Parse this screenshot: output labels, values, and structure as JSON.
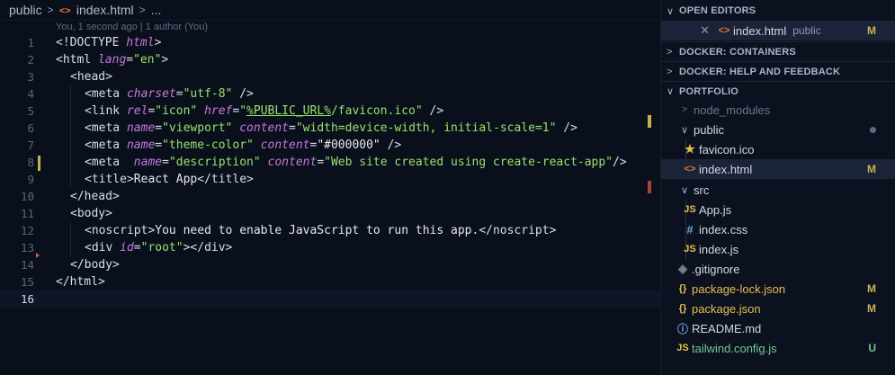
{
  "breadcrumb": {
    "folder": "public",
    "file": "index.html",
    "more": "..."
  },
  "blame": "You, 1 second ago | 1 author (You)",
  "editor": {
    "lines": [
      {
        "n": "1"
      },
      {
        "n": "2"
      },
      {
        "n": "3"
      },
      {
        "n": "4"
      },
      {
        "n": "5"
      },
      {
        "n": "6"
      },
      {
        "n": "7"
      },
      {
        "n": "8"
      },
      {
        "n": "9"
      },
      {
        "n": "10"
      },
      {
        "n": "11"
      },
      {
        "n": "12"
      },
      {
        "n": "13"
      },
      {
        "n": "14"
      },
      {
        "n": "15"
      },
      {
        "n": "16"
      }
    ],
    "code": {
      "l1_doctype": "<!DOCTYPE ",
      "l1_html": "html",
      "l1_close": ">",
      "l2_open": "<html ",
      "l2_attr": "lang",
      "l2_eq": "=",
      "l2_val": "\"en\"",
      "l2_close": ">",
      "l3": "<head>",
      "l4_open": "<meta ",
      "l4_attr": "charset",
      "l4_eq": "=",
      "l4_val": "\"utf-8\"",
      "l4_close": " />",
      "l5_open": "<link ",
      "l5_attr1": "rel",
      "l5_eq1": "=",
      "l5_val1": "\"icon\"",
      "l5_sp": " ",
      "l5_attr2": "href",
      "l5_eq2": "=",
      "l5_q1": "\"",
      "l5_val2": "%PUBLIC_URL%",
      "l5_val2b": "/favicon.ico",
      "l5_q2": "\"",
      "l5_close": " />",
      "l6_open": "<meta ",
      "l6_attr1": "name",
      "l6_eq1": "=",
      "l6_val1": "\"viewport\"",
      "l6_sp": " ",
      "l6_attr2": "content",
      "l6_eq2": "=",
      "l6_val2": "\"width=device-width, initial-scale=1\"",
      "l6_close": " />",
      "l7_open": "<meta ",
      "l7_attr1": "name",
      "l7_eq1": "=",
      "l7_val1": "\"theme-color\"",
      "l7_sp": " ",
      "l7_attr2": "content",
      "l7_eq2": "=",
      "l7_val2": "\"#000000\"",
      "l7_close": " />",
      "l8_open": "<meta  ",
      "l8_attr1": "name",
      "l8_eq1": "=",
      "l8_val1": "\"description\"",
      "l8_sp": " ",
      "l8_attr2": "content",
      "l8_eq2": "=",
      "l8_val2": "\"Web site created using create-react-app\"",
      "l8_close": "/>",
      "l9_open": "<title>",
      "l9_text": "React App",
      "l9_close": "</title>",
      "l10": "</head>",
      "l11": "<body>",
      "l12_open": "<noscript>",
      "l12_text": "You need to enable JavaScript to run this app.",
      "l12_close": "</noscript>",
      "l13_open": "<div ",
      "l13_attr": "id",
      "l13_eq": "=",
      "l13_val": "\"root\"",
      "l13_close": "></div>",
      "l14": "</body>",
      "l15": "</html>"
    }
  },
  "sidebar": {
    "open_editors": {
      "header": "OPEN EDITORS",
      "item": {
        "name": "index.html",
        "folder": "public",
        "status": "M"
      }
    },
    "docker_containers": "DOCKER: CONTAINERS",
    "docker_help": "DOCKER: HELP AND FEEDBACK",
    "portfolio": {
      "header": "PORTFOLIO",
      "items": [
        {
          "name": "node_modules"
        },
        {
          "name": "public"
        },
        {
          "name": "favicon.ico"
        },
        {
          "name": "index.html",
          "status": "M"
        },
        {
          "name": "src"
        },
        {
          "name": "App.js"
        },
        {
          "name": "index.css"
        },
        {
          "name": "index.js"
        },
        {
          "name": ".gitignore"
        },
        {
          "name": "package-lock.json",
          "status": "M"
        },
        {
          "name": "package.json",
          "status": "M"
        },
        {
          "name": "README.md"
        },
        {
          "name": "tailwind.config.js",
          "status": "U"
        }
      ]
    }
  },
  "colors": {
    "background": "#0a0f1c",
    "modified": "#c7b34e",
    "untracked": "#73c991",
    "tag_attr": "#c678dd",
    "string": "#98e36b"
  }
}
